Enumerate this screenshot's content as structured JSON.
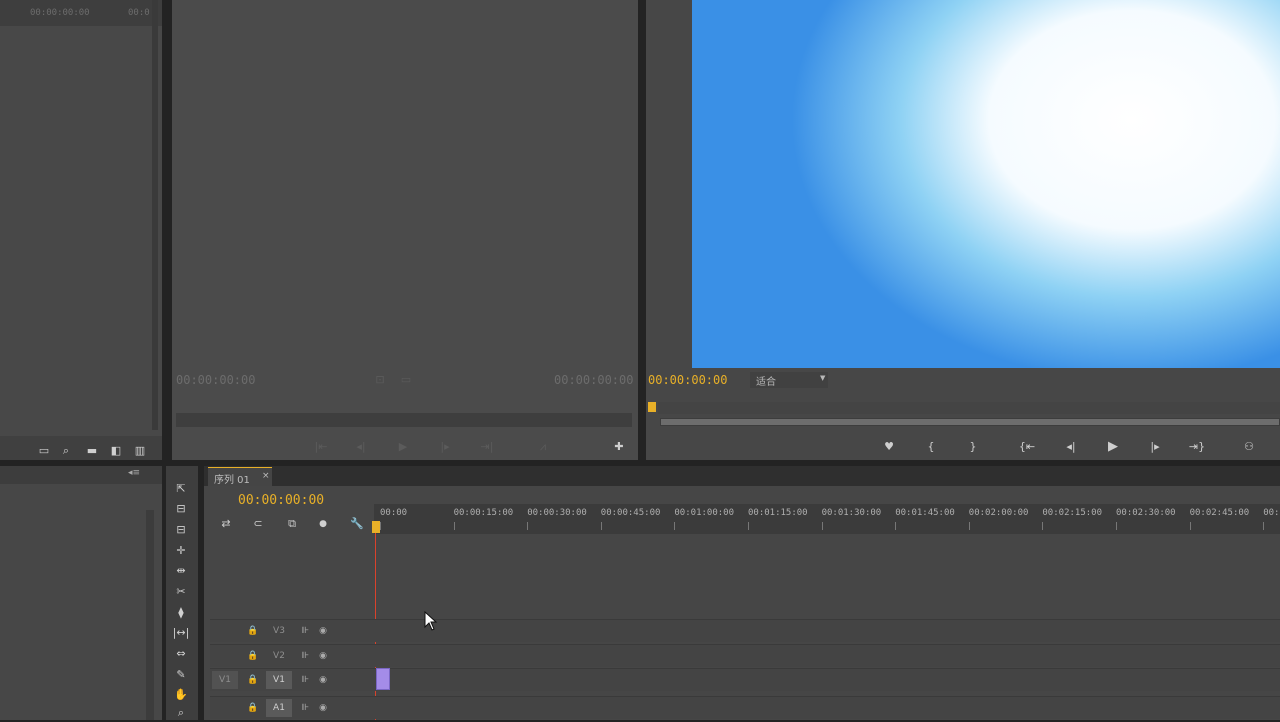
{
  "project_panel": {
    "timecode_a": "00:00:00:00",
    "timecode_b": "00:0"
  },
  "source_monitor": {
    "timecode_in": "00:00:00:00",
    "timecode_duration": "00:00:00:00"
  },
  "program_monitor": {
    "timecode": "00:00:00:00",
    "fit_label": "适合"
  },
  "timeline": {
    "sequence_tab": "序列 01",
    "timecode": "00:00:00:00",
    "ruler_ticks": [
      "00:00",
      "00:00:15:00",
      "00:00:30:00",
      "00:00:45:00",
      "00:01:00:00",
      "00:01:15:00",
      "00:01:30:00",
      "00:01:45:00",
      "00:02:00:00",
      "00:02:15:00",
      "00:02:30:00",
      "00:02:45:00",
      "00:03:00"
    ],
    "tracks": [
      {
        "name": "V3"
      },
      {
        "name": "V2"
      },
      {
        "name": "V1",
        "source": "V1"
      },
      {
        "name": "A1"
      }
    ]
  },
  "colors": {
    "accent": "#e8b028",
    "clip": "#a48ce8",
    "playhead": "#d9422c"
  },
  "icons": [
    "selection-tool-icon",
    "track-select-icon",
    "ripple-edit-icon",
    "rolling-edit-icon",
    "rate-stretch-icon",
    "razor-icon",
    "slip-icon",
    "slide-icon",
    "pen-icon",
    "hand-icon",
    "zoom-icon",
    "marker-icon",
    "play-icon",
    "lock-icon",
    "eye-icon",
    "wrench-icon"
  ]
}
